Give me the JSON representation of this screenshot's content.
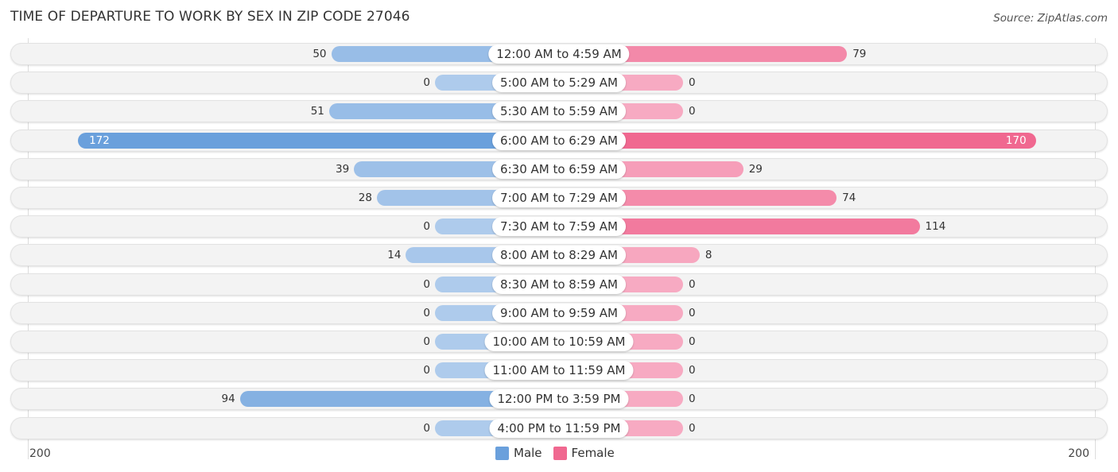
{
  "title": "TIME OF DEPARTURE TO WORK BY SEX IN ZIP CODE 27046",
  "source": "Source: ZipAtlas.com",
  "chart_data": {
    "type": "bar",
    "orientation": "horizontal-diverging",
    "title": "TIME OF DEPARTURE TO WORK BY SEX IN ZIP CODE 27046",
    "categories": [
      "12:00 AM to 4:59 AM",
      "5:00 AM to 5:29 AM",
      "5:30 AM to 5:59 AM",
      "6:00 AM to 6:29 AM",
      "6:30 AM to 6:59 AM",
      "7:00 AM to 7:29 AM",
      "7:30 AM to 7:59 AM",
      "8:00 AM to 8:29 AM",
      "8:30 AM to 8:59 AM",
      "9:00 AM to 9:59 AM",
      "10:00 AM to 10:59 AM",
      "11:00 AM to 11:59 AM",
      "12:00 PM to 3:59 PM",
      "4:00 PM to 11:59 PM"
    ],
    "series": [
      {
        "name": "Male",
        "color": "#6aa0dc",
        "values": [
          50,
          0,
          51,
          172,
          39,
          28,
          0,
          14,
          0,
          0,
          0,
          0,
          94,
          0
        ]
      },
      {
        "name": "Female",
        "color": "#f06890",
        "values": [
          79,
          0,
          0,
          170,
          29,
          74,
          114,
          8,
          0,
          0,
          0,
          0,
          0,
          0
        ]
      }
    ],
    "axis_left_label": "200",
    "axis_right_label": "200",
    "xlim": [
      -200,
      200
    ],
    "legend": [
      "Male",
      "Female"
    ],
    "legend_position": "bottom-center"
  }
}
